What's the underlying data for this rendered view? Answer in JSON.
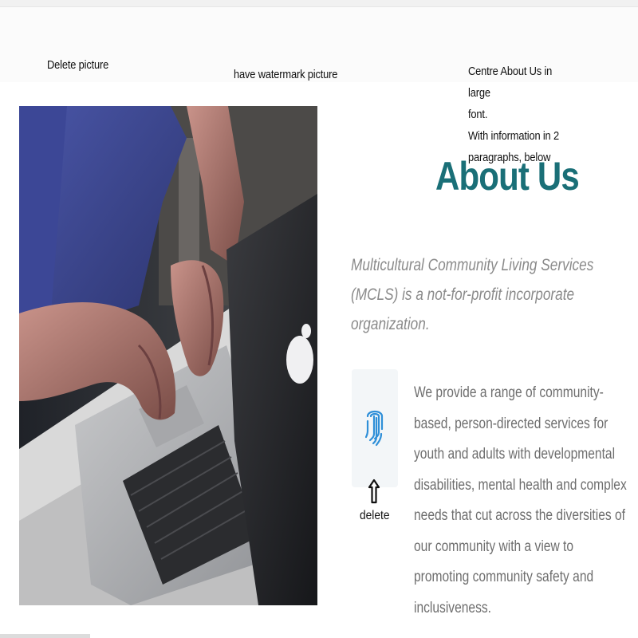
{
  "notes": {
    "delete_picture": "Delete picture",
    "watermark_picture": "have watermark picture",
    "centre_line1": "Centre About Us in large",
    "centre_line2": "font.",
    "centre_line3": "With information in 2",
    "centre_line4": "paragraphs, below",
    "delete": "delete"
  },
  "about": {
    "title": "About Us",
    "lead": "Multicultural Community Living Services (MCLS) is a not-for-profit incorporate organization.",
    "body": "We provide a range of community-based, person-directed services for youth and adults with developmental disabilities, mental health and complex needs that cut across the diversities of our community with a view to promoting community safety and inclusiveness."
  },
  "icons": {
    "feature": "fingerprint-icon",
    "annotation": "arrow-up-icon"
  },
  "colors": {
    "title": "#1a6f77",
    "icon": "#2f8fd8",
    "lead_text": "#8a8a8a",
    "body_text": "#6e6e6e"
  }
}
